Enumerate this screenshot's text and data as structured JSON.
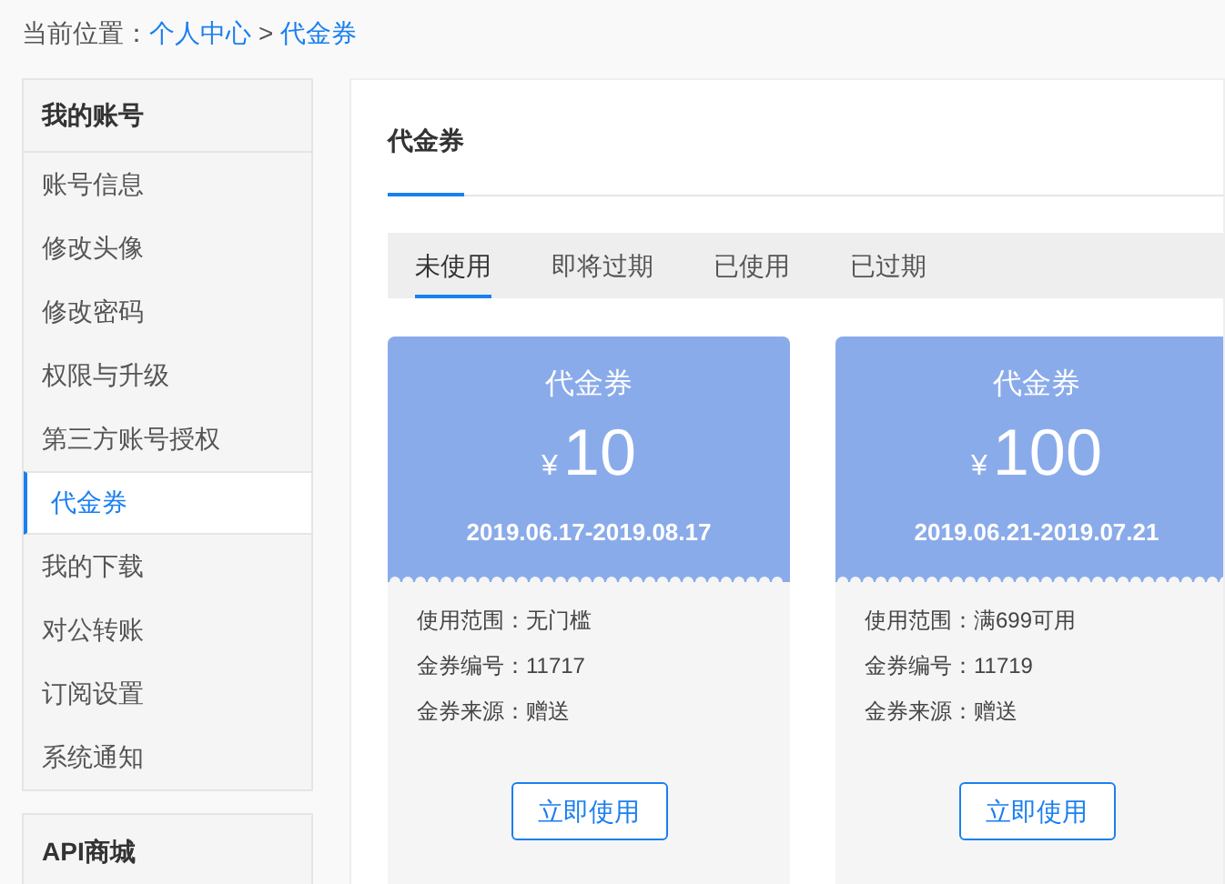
{
  "breadcrumb": {
    "label": "当前位置：",
    "links": [
      "个人中心",
      "代金券"
    ],
    "separator": ">"
  },
  "sidebar": {
    "sections": [
      {
        "title": "我的账号",
        "items": [
          {
            "label": "账号信息",
            "selected": false
          },
          {
            "label": "修改头像",
            "selected": false
          },
          {
            "label": "修改密码",
            "selected": false
          },
          {
            "label": "权限与升级",
            "selected": false
          },
          {
            "label": "第三方账号授权",
            "selected": false
          },
          {
            "label": "代金券",
            "selected": true
          },
          {
            "label": "我的下载",
            "selected": false
          },
          {
            "label": "对公转账",
            "selected": false
          },
          {
            "label": "订阅设置",
            "selected": false
          },
          {
            "label": "系统通知",
            "selected": false
          }
        ]
      },
      {
        "title": "API商城"
      }
    ]
  },
  "main": {
    "title": "代金券",
    "tabs": [
      {
        "label": "未使用",
        "selected": true
      },
      {
        "label": "即将过期",
        "selected": false
      },
      {
        "label": "已使用",
        "selected": false
      },
      {
        "label": "已过期",
        "selected": false
      }
    ],
    "coupons": [
      {
        "name": "代金券",
        "currency": "¥",
        "amount": "10",
        "period": "2019.06.17-2019.08.17",
        "details": [
          {
            "label": "使用范围：",
            "value": "无门槛"
          },
          {
            "label": "金券编号：",
            "value": "11717"
          },
          {
            "label": "金券来源：",
            "value": "赠送"
          }
        ],
        "button": "立即使用"
      },
      {
        "name": "代金券",
        "currency": "¥",
        "amount": "100",
        "period": "2019.06.21-2019.07.21",
        "details": [
          {
            "label": "使用范围：",
            "value": "满699可用"
          },
          {
            "label": "金券编号：",
            "value": "11719"
          },
          {
            "label": "金券来源：",
            "value": "赠送"
          }
        ],
        "button": "立即使用"
      }
    ]
  }
}
